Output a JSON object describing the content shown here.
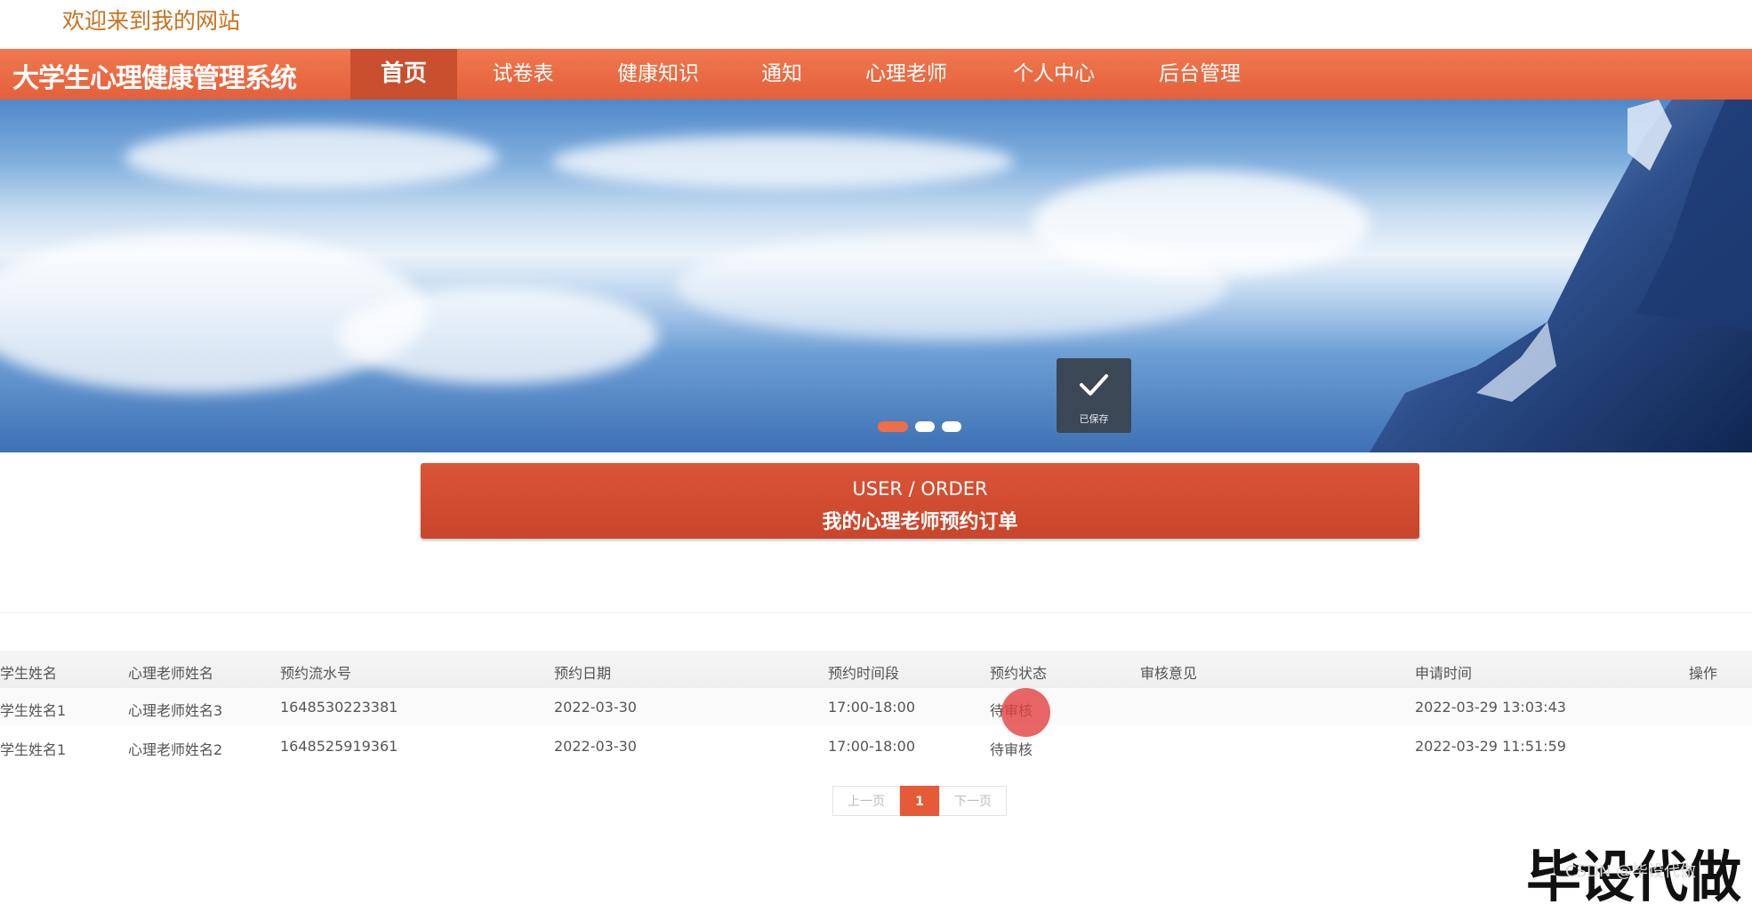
{
  "header": {
    "welcome": "欢迎来到我的网站"
  },
  "navbar": {
    "brand": "大学生心理健康管理系统",
    "items": [
      {
        "label": "首页",
        "active": true
      },
      {
        "label": "试卷表"
      },
      {
        "label": "健康知识"
      },
      {
        "label": "通知"
      },
      {
        "label": "心理老师"
      },
      {
        "label": "个人中心"
      },
      {
        "label": "后台管理"
      }
    ]
  },
  "banner": {
    "slides": 3,
    "active_slide": 1
  },
  "toast": {
    "message": "已保存"
  },
  "section": {
    "title_en": "USER / ORDER",
    "title_zh": "我的心理老师预约订单"
  },
  "table": {
    "headers": [
      "学生姓名",
      "心理老师姓名",
      "预约流水号",
      "预约日期",
      "预约时间段",
      "预约状态",
      "审核意见",
      "申请时间",
      "操作"
    ],
    "rows": [
      [
        "学生姓名1",
        "心理老师姓名3",
        "1648530223381",
        "2022-03-30",
        "17:00-18:00",
        "待审核",
        "",
        "2022-03-29 13:03:43",
        ""
      ],
      [
        "学生姓名1",
        "心理老师姓名2",
        "1648525919361",
        "2022-03-30",
        "17:00-18:00",
        "待审核",
        "",
        "2022-03-29 11:51:59",
        ""
      ]
    ]
  },
  "pagination": {
    "prev": "上一页",
    "current": "1",
    "next": "下一页"
  },
  "watermark": {
    "big": "毕设代做",
    "small": "CSDN @毕设代做"
  },
  "colors": {
    "nav": "#e8663f",
    "nav_active": "#c94f2f",
    "accent": "#d24c31",
    "welcome": "#c8721d"
  }
}
